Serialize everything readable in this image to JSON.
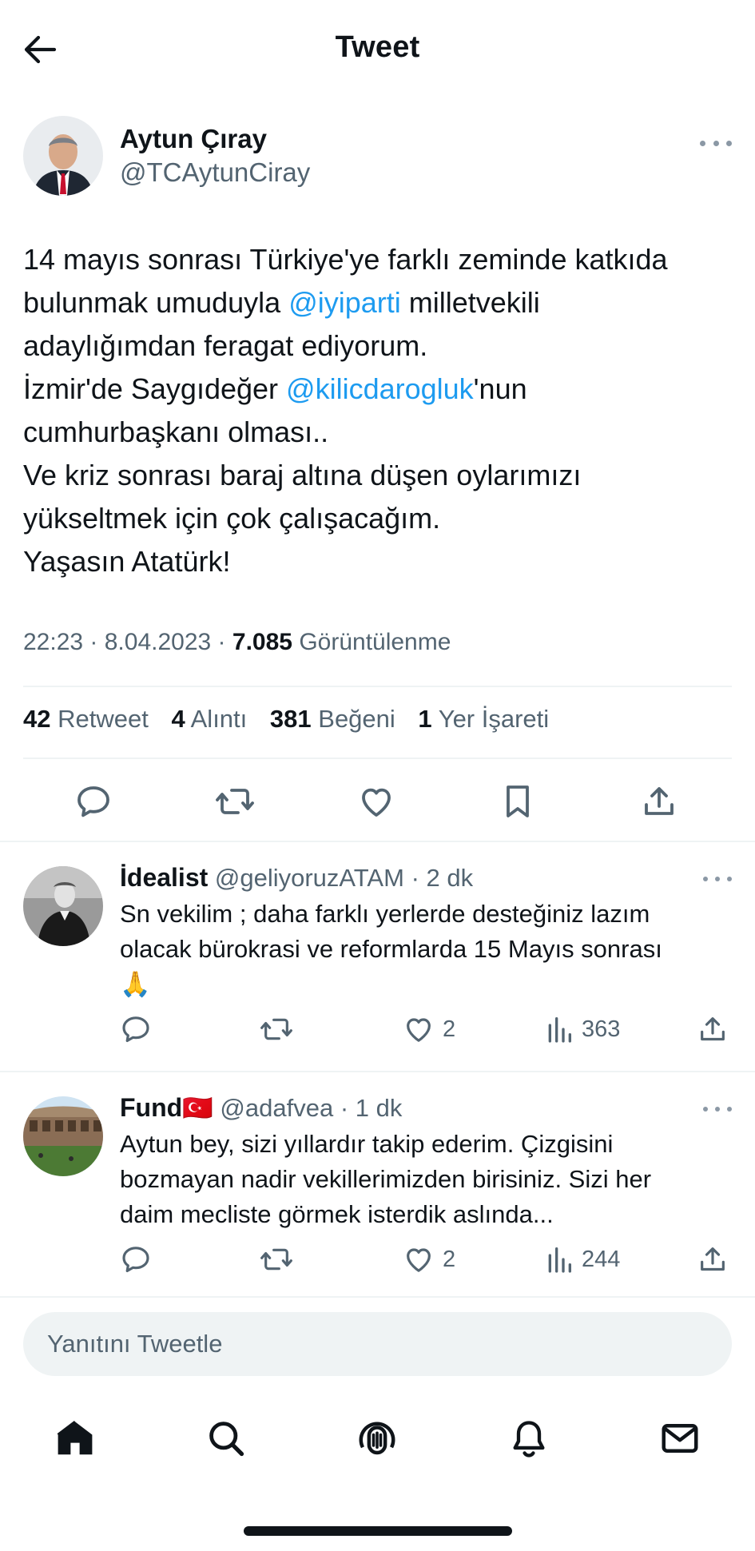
{
  "header": {
    "title": "Tweet"
  },
  "tweet": {
    "author_name": "Aytun Çıray",
    "author_handle": "@TCAytunCiray",
    "text_lines": [
      {
        "before": "14 mayıs sonrası Türkiye'ye farklı zeminde katkıda",
        "mention": "",
        "after": ""
      },
      {
        "before": "bulunmak umuduyla ",
        "mention": "@iyiparti",
        "after": " milletvekili"
      },
      {
        "before": "adaylığımdan feragat ediyorum.",
        "mention": "",
        "after": ""
      },
      {
        "before": "İzmir'de Saygıdeğer ",
        "mention": "@kilicdarogluk",
        "after": "'nun"
      },
      {
        "before": "cumhurbaşkanı olması..",
        "mention": "",
        "after": ""
      },
      {
        "before": "Ve kriz sonrası baraj altına düşen oylarımızı",
        "mention": "",
        "after": ""
      },
      {
        "before": "yükseltmek için çok çalışacağım.",
        "mention": "",
        "after": ""
      },
      {
        "before": "Yaşasın Atatürk!",
        "mention": "",
        "after": ""
      }
    ],
    "time": "22:23",
    "date": "8.04.2023",
    "views": "7.085",
    "views_label": "Görüntülenme",
    "stats": {
      "retweets": "42",
      "retweets_label": "Retweet",
      "quotes": "4",
      "quotes_label": "Alıntı",
      "likes": "381",
      "likes_label": "Beğeni",
      "bookmarks": "1",
      "bookmarks_label": "Yer İşareti"
    }
  },
  "replies": [
    {
      "name": "İdealist",
      "handle": "@geliyoruzATAM",
      "time": "2 dk",
      "flag": "",
      "text_lines": [
        "Sn vekilim ; daha farklı yerlerde desteğiniz lazım",
        "olacak bürokrasi ve reformlarda 15 Mayıs sonrası",
        "🙏"
      ],
      "likes": "2",
      "views": "363"
    },
    {
      "name": "Fund",
      "handle": "@adafvea",
      "time": "1 dk",
      "flag": "🇹🇷",
      "text_lines": [
        "Aytun bey, sizi yıllardır takip ederim. Çizgisini",
        "bozmayan nadir vekillerimizden birisiniz. Sizi her",
        "daim mecliste görmek isterdik aslında..."
      ],
      "likes": "2",
      "views": "244"
    }
  ],
  "reply_box": {
    "placeholder": "Yanıtını Tweetle"
  },
  "colors": {
    "accent": "#1d9bf0",
    "text": "#0f1419",
    "secondary": "#536471",
    "divider": "#eff3f4"
  },
  "icons": [
    "back-arrow-icon",
    "more-icon",
    "reply-icon",
    "retweet-icon",
    "like-icon",
    "bookmark-icon",
    "share-icon",
    "views-icon",
    "home-icon",
    "search-icon",
    "spaces-icon",
    "notifications-icon",
    "messages-icon"
  ]
}
